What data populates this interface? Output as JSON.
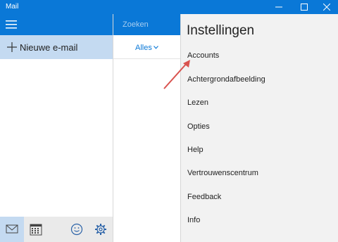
{
  "window": {
    "title": "Mail"
  },
  "left": {
    "new_mail_label": "Nieuwe e-mail"
  },
  "middle": {
    "search_placeholder": "Zoeken",
    "filter_label": "Alles"
  },
  "settings": {
    "title": "Instellingen",
    "items": [
      {
        "label": "Accounts"
      },
      {
        "label": "Achtergrondafbeelding"
      },
      {
        "label": "Lezen"
      },
      {
        "label": "Opties"
      },
      {
        "label": "Help"
      },
      {
        "label": "Vertrouwenscentrum"
      },
      {
        "label": "Feedback"
      },
      {
        "label": "Info"
      }
    ]
  },
  "colors": {
    "accent": "#0a78d7",
    "selected": "#c4daf1",
    "annotation_arrow": "#d9534f"
  },
  "icons": [
    "minimize-icon",
    "maximize-icon",
    "close-icon",
    "hamburger-icon",
    "plus-icon",
    "mail-icon",
    "calendar-icon",
    "smiley-icon",
    "gear-icon",
    "chevron-down-icon"
  ]
}
